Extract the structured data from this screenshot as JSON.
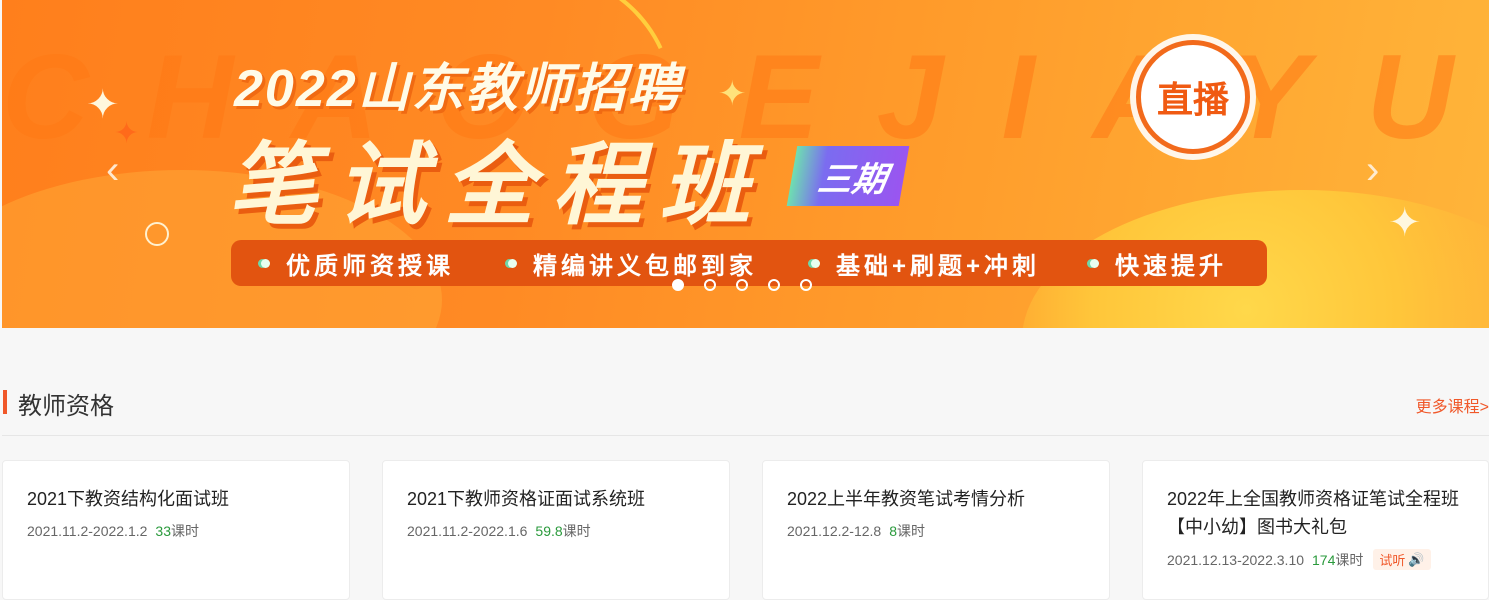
{
  "banner": {
    "bg_text": "CHAOGEJIAYU",
    "title_line1": "2022山东教师招聘",
    "title_line2": "笔试全程班",
    "period_badge": "三期",
    "live_seal": "直播",
    "features": [
      "优质师资授课",
      "精编讲义包邮到家",
      "基础+刷题+冲刺",
      "快速提升"
    ],
    "prev_arrow": "‹",
    "next_arrow": "›",
    "slide_count": 5,
    "active_slide": 1
  },
  "section": {
    "title": "教师资格",
    "more_link": "更多课程>"
  },
  "courses": [
    {
      "title": "2021下教资结构化面试班",
      "dates": "2021.11.2-2022.1.2",
      "lessons": "33",
      "unit": "课时",
      "trial": ""
    },
    {
      "title": "2021下教师资格证面试系统班",
      "dates": "2021.11.2-2022.1.6",
      "lessons": "59.8",
      "unit": "课时",
      "trial": ""
    },
    {
      "title": "2022上半年教资笔试考情分析",
      "dates": "2021.12.2-12.8",
      "lessons": "8",
      "unit": "课时",
      "trial": ""
    },
    {
      "title": "2022年上全国教师资格证笔试全程班【中小幼】图书大礼包",
      "dates": "2021.12.13-2022.3.10",
      "lessons": "174",
      "unit": "课时",
      "trial": "试听"
    }
  ],
  "colors": {
    "accent": "#f0582a",
    "lessons_green": "#2a9a3c",
    "banner_orange": "#ff8a24"
  }
}
